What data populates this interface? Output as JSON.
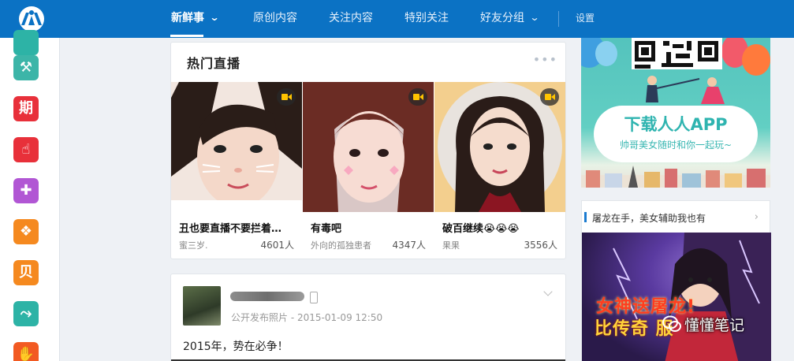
{
  "nav": {
    "items": [
      {
        "label": "新鲜事",
        "active": true,
        "has_dropdown": true
      },
      {
        "label": "原创内容",
        "active": false,
        "has_dropdown": false
      },
      {
        "label": "关注内容",
        "active": false,
        "has_dropdown": false
      },
      {
        "label": "特别关注",
        "active": false,
        "has_dropdown": false
      },
      {
        "label": "好友分组",
        "active": false,
        "has_dropdown": true
      }
    ],
    "settings_label": "设置"
  },
  "sidebar": {
    "icons": [
      {
        "name": "app-icon-teal",
        "glyph": "",
        "color": "#2db3a6"
      },
      {
        "name": "tools-icon",
        "glyph": "⚒",
        "color": "#3cb5a8"
      },
      {
        "name": "periodical-icon",
        "glyph": "期",
        "color": "#e8303a"
      },
      {
        "name": "hand-icon",
        "glyph": "☝",
        "color": "#e8303a"
      },
      {
        "name": "gamepad-icon",
        "glyph": "✚",
        "color": "#b156d4"
      },
      {
        "name": "grid-icon",
        "glyph": "❖",
        "color": "#f5891f"
      },
      {
        "name": "shell-icon",
        "glyph": "贝",
        "color": "#f5891f"
      },
      {
        "name": "sign-icon",
        "glyph": "⤳",
        "color": "#2db3a6"
      },
      {
        "name": "palm-icon",
        "glyph": "✋",
        "color": "#f25a22"
      }
    ]
  },
  "live": {
    "title": "热门直播",
    "streams": [
      {
        "title": "丑也要直播不要拦着…",
        "user": "蜜三岁.",
        "count": "4601人"
      },
      {
        "title": "有毒吧",
        "user": "外向的孤独患者",
        "count": "4347人"
      },
      {
        "title": "破百继续😭😭😭",
        "user": "果果",
        "count": "3556人"
      }
    ]
  },
  "post": {
    "meta": "公开发布照片 - 2015-01-09 12:50",
    "text": "2015年，势在必争！"
  },
  "ad_download": {
    "title": "下载人人APP",
    "subtitle": "帅哥美女随时和你一起玩~"
  },
  "ad_game": {
    "title": "屠龙在手，美女辅助我也有",
    "headline1": "女神送屠龙!",
    "headline2": "比传奇    服"
  },
  "watermark": "懂懂笔记"
}
